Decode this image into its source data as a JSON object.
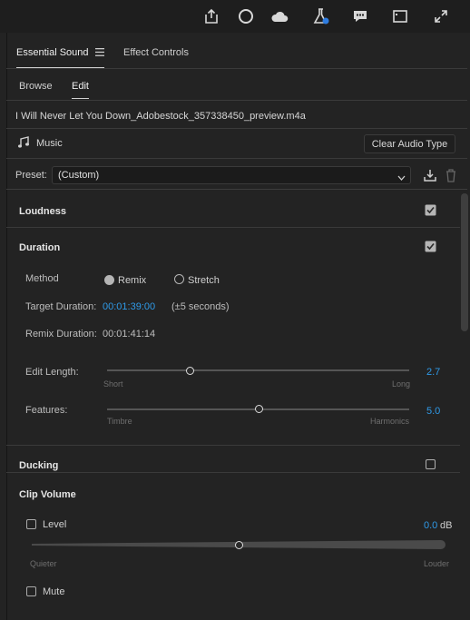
{
  "topbar": {
    "icons": [
      "share-icon",
      "circle-icon",
      "cloud-icon",
      "beta-flask-icon",
      "comments-icon",
      "panel-icon",
      "expand-icon"
    ]
  },
  "tabs": {
    "essential_sound": "Essential Sound",
    "effect_controls": "Effect Controls"
  },
  "subtabs": {
    "browse": "Browse",
    "edit": "Edit"
  },
  "clip": {
    "filename": "I Will Never Let You Down_Adobestock_357338450_preview.m4a"
  },
  "type": {
    "label": "Music",
    "clear_button": "Clear Audio Type"
  },
  "preset": {
    "label": "Preset:",
    "value": "(Custom)"
  },
  "loudness": {
    "title": "Loudness",
    "checked": true
  },
  "duration": {
    "title": "Duration",
    "checked": true,
    "method_label": "Method",
    "remix_label": "Remix",
    "stretch_label": "Stretch",
    "selected": "remix",
    "target_label": "Target Duration:",
    "target_value": "00:01:39:00",
    "tolerance": "(±5 seconds)",
    "remix_label2": "Remix Duration:",
    "remix_value": "00:01:41:14",
    "edit_length": {
      "label": "Edit Length:",
      "min_label": "Short",
      "max_label": "Long",
      "value": "2.7"
    },
    "features": {
      "label": "Features:",
      "min_label": "Timbre",
      "max_label": "Harmonics",
      "value": "5.0"
    }
  },
  "ducking": {
    "title": "Ducking",
    "checked": false
  },
  "clip_volume": {
    "title": "Clip Volume",
    "level_label": "Level",
    "level_value": "0.0",
    "unit": "dB",
    "min_label": "Quieter",
    "max_label": "Louder",
    "mute_label": "Mute"
  },
  "colors": {
    "accent": "#2f9ae8",
    "background": "#232323"
  }
}
